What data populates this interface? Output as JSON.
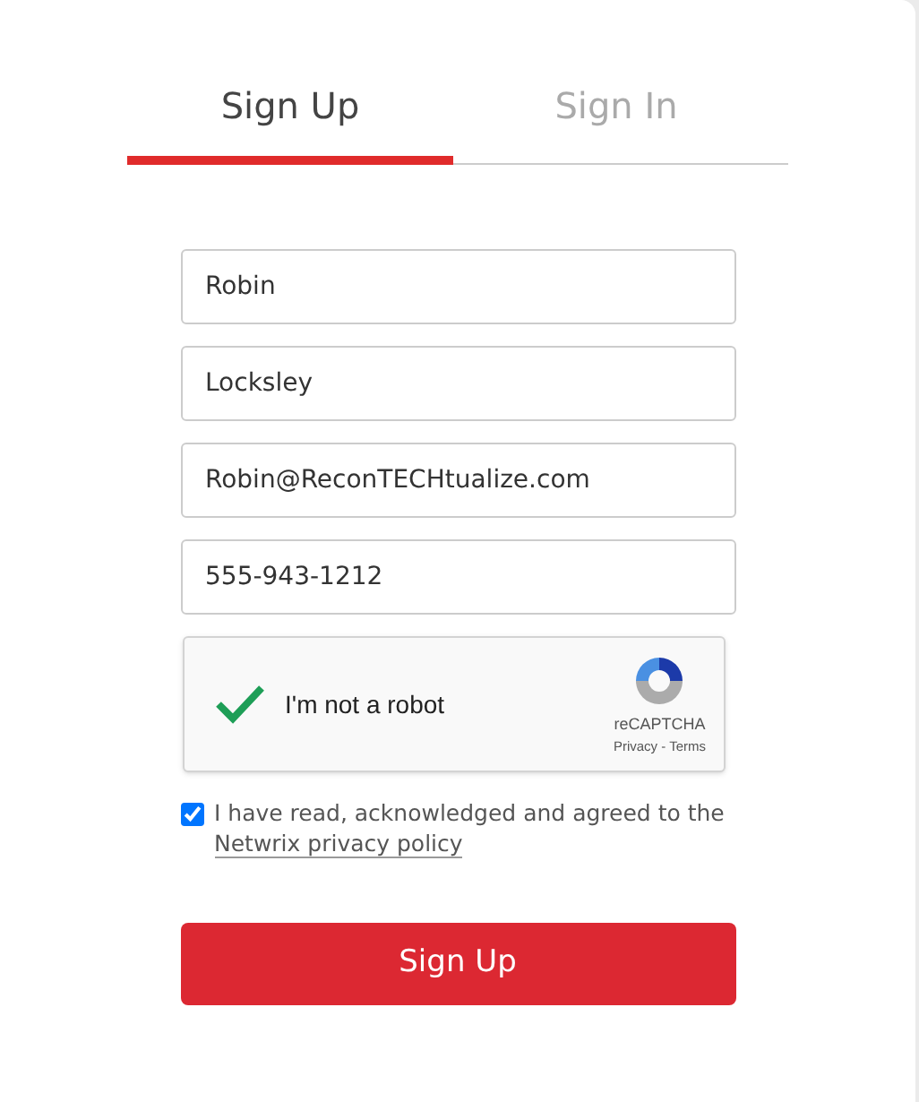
{
  "tabs": [
    {
      "label": "Sign Up",
      "selected": true
    },
    {
      "label": "Sign In",
      "selected": false
    }
  ],
  "fields": [
    {
      "value": "Robin"
    },
    {
      "value": "Locksley"
    },
    {
      "value": "Robin@ReconTECHtualize.com"
    },
    {
      "value": "555-943-1212"
    }
  ],
  "captcha": {
    "verified": true,
    "label": "I'm not a robot",
    "brand": "reCAPTCHA",
    "links": "Privacy - Terms"
  },
  "consent": {
    "checked": true,
    "text": "I have read, acknowledged and agreed to the",
    "link": "Netwrix privacy policy"
  },
  "submit": "Sign Up"
}
